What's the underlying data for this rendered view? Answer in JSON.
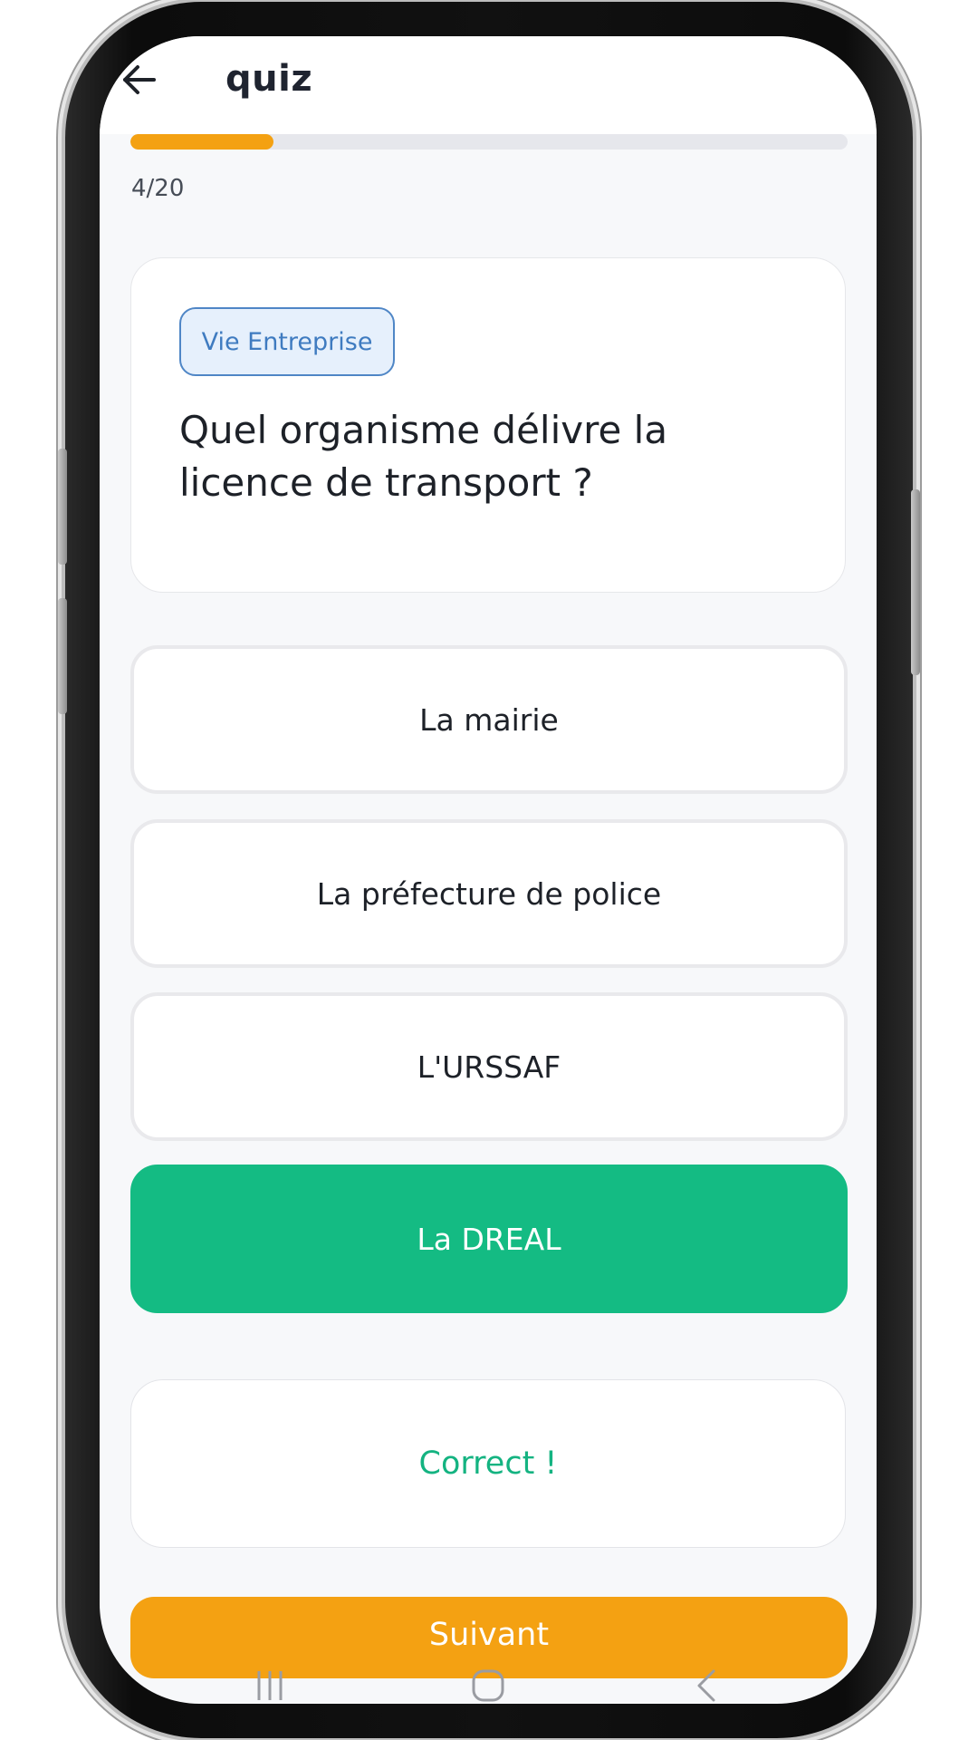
{
  "header": {
    "title": "quiz",
    "back_icon": "arrow-left-icon"
  },
  "progress": {
    "current": 4,
    "total": 20,
    "label": "4/20",
    "fraction": 0.2,
    "color": "#f4a112"
  },
  "question": {
    "category": "Vie Entreprise",
    "text": "Quel organisme délivre la licence de transport ?"
  },
  "answers": [
    {
      "label": "La mairie",
      "selected": false
    },
    {
      "label": "La préfecture de police",
      "selected": false
    },
    {
      "label": "L'URSSAF",
      "selected": false
    },
    {
      "label": "La DREAL",
      "selected": true
    }
  ],
  "feedback": {
    "text": "Correct !",
    "color": "#14b381"
  },
  "actions": {
    "next_label": "Suivant"
  },
  "colors": {
    "accent": "#f4a112",
    "success": "#14bb83",
    "chip_border": "#4f86c6",
    "chip_background": "#e6f0fc"
  },
  "system_nav": {
    "recent_icon": "recent-apps-icon",
    "home_icon": "home-icon",
    "back_icon": "nav-back-icon"
  }
}
